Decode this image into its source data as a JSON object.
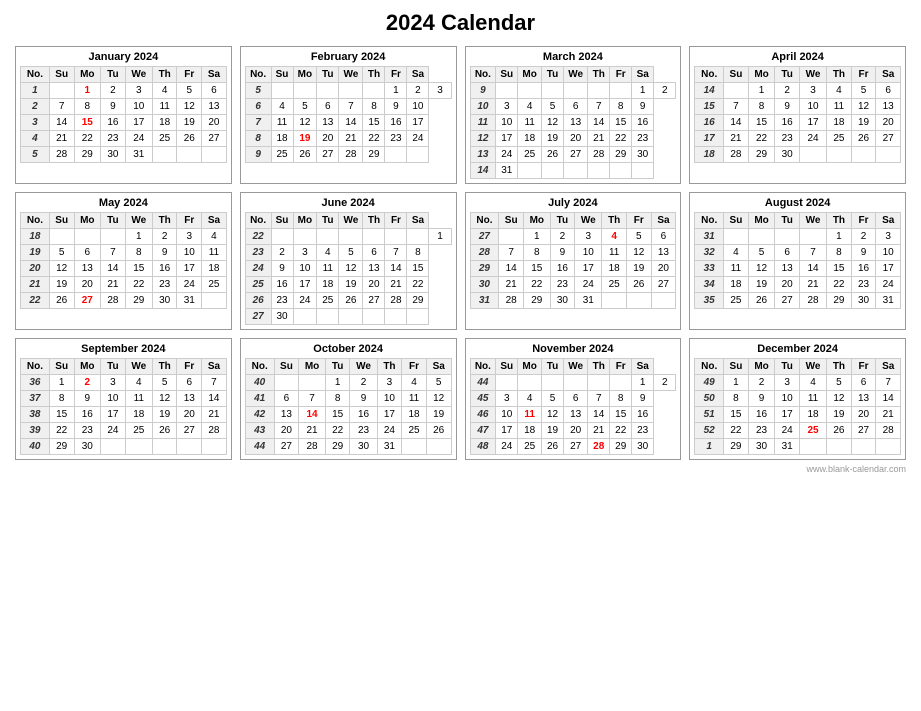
{
  "title": "2024 Calendar",
  "watermark": "www.blank-calendar.com",
  "months": [
    {
      "name": "January 2024",
      "days_header": [
        "No.",
        "Su",
        "Mo",
        "Tu",
        "We",
        "Th",
        "Fr",
        "Sa"
      ],
      "weeks": [
        {
          "num": "1",
          "days": [
            "",
            "1",
            "2",
            "3",
            "4",
            "5",
            "6"
          ],
          "holidays": [
            1
          ]
        },
        {
          "num": "2",
          "days": [
            "7",
            "8",
            "9",
            "10",
            "11",
            "12",
            "13"
          ],
          "holidays": []
        },
        {
          "num": "3",
          "days": [
            "14",
            "15",
            "16",
            "17",
            "18",
            "19",
            "20"
          ],
          "holidays": [
            15
          ]
        },
        {
          "num": "4",
          "days": [
            "21",
            "22",
            "23",
            "24",
            "25",
            "26",
            "27"
          ],
          "holidays": []
        },
        {
          "num": "5",
          "days": [
            "28",
            "29",
            "30",
            "31",
            "",
            "",
            ""
          ],
          "holidays": []
        }
      ]
    },
    {
      "name": "February 2024",
      "days_header": [
        "No.",
        "Su",
        "Mo",
        "Tu",
        "We",
        "Th",
        "Fr",
        "Sa"
      ],
      "weeks": [
        {
          "num": "5",
          "days": [
            "",
            "",
            "",
            "",
            "",
            "1",
            "2",
            "3"
          ],
          "holidays": []
        },
        {
          "num": "6",
          "days": [
            "4",
            "5",
            "6",
            "7",
            "8",
            "9",
            "10"
          ],
          "holidays": []
        },
        {
          "num": "7",
          "days": [
            "11",
            "12",
            "13",
            "14",
            "15",
            "16",
            "17"
          ],
          "holidays": []
        },
        {
          "num": "8",
          "days": [
            "18",
            "19",
            "20",
            "21",
            "22",
            "23",
            "24"
          ],
          "holidays": [
            19
          ]
        },
        {
          "num": "9",
          "days": [
            "25",
            "26",
            "27",
            "28",
            "29",
            "",
            ""
          ],
          "holidays": []
        }
      ]
    },
    {
      "name": "March 2024",
      "days_header": [
        "No.",
        "Su",
        "Mo",
        "Tu",
        "We",
        "Th",
        "Fr",
        "Sa"
      ],
      "weeks": [
        {
          "num": "9",
          "days": [
            "",
            "",
            "",
            "",
            "",
            "",
            "1",
            "2"
          ],
          "holidays": []
        },
        {
          "num": "10",
          "days": [
            "3",
            "4",
            "5",
            "6",
            "7",
            "8",
            "9"
          ],
          "holidays": []
        },
        {
          "num": "11",
          "days": [
            "10",
            "11",
            "12",
            "13",
            "14",
            "15",
            "16"
          ],
          "holidays": []
        },
        {
          "num": "12",
          "days": [
            "17",
            "18",
            "19",
            "20",
            "21",
            "22",
            "23"
          ],
          "holidays": []
        },
        {
          "num": "13",
          "days": [
            "24",
            "25",
            "26",
            "27",
            "28",
            "29",
            "30"
          ],
          "holidays": []
        },
        {
          "num": "14",
          "days": [
            "31",
            "",
            "",
            "",
            "",
            "",
            ""
          ],
          "holidays": []
        }
      ]
    },
    {
      "name": "April 2024",
      "days_header": [
        "No.",
        "Su",
        "Mo",
        "Tu",
        "We",
        "Th",
        "Fr",
        "Sa"
      ],
      "weeks": [
        {
          "num": "14",
          "days": [
            "",
            "1",
            "2",
            "3",
            "4",
            "5",
            "6"
          ],
          "holidays": []
        },
        {
          "num": "15",
          "days": [
            "7",
            "8",
            "9",
            "10",
            "11",
            "12",
            "13"
          ],
          "holidays": []
        },
        {
          "num": "16",
          "days": [
            "14",
            "15",
            "16",
            "17",
            "18",
            "19",
            "20"
          ],
          "holidays": []
        },
        {
          "num": "17",
          "days": [
            "21",
            "22",
            "23",
            "24",
            "25",
            "26",
            "27"
          ],
          "holidays": []
        },
        {
          "num": "18",
          "days": [
            "28",
            "29",
            "30",
            "",
            "",
            "",
            ""
          ],
          "holidays": []
        }
      ]
    },
    {
      "name": "May 2024",
      "days_header": [
        "No.",
        "Su",
        "Mo",
        "Tu",
        "We",
        "Th",
        "Fr",
        "Sa"
      ],
      "weeks": [
        {
          "num": "18",
          "days": [
            "",
            "",
            "",
            "1",
            "2",
            "3",
            "4"
          ],
          "holidays": []
        },
        {
          "num": "19",
          "days": [
            "5",
            "6",
            "7",
            "8",
            "9",
            "10",
            "11"
          ],
          "holidays": []
        },
        {
          "num": "20",
          "days": [
            "12",
            "13",
            "14",
            "15",
            "16",
            "17",
            "18"
          ],
          "holidays": []
        },
        {
          "num": "21",
          "days": [
            "19",
            "20",
            "21",
            "22",
            "23",
            "24",
            "25"
          ],
          "holidays": []
        },
        {
          "num": "22",
          "days": [
            "26",
            "27",
            "28",
            "29",
            "30",
            "31",
            ""
          ],
          "holidays": [
            27
          ]
        }
      ]
    },
    {
      "name": "June 2024",
      "days_header": [
        "No.",
        "Su",
        "Mo",
        "Tu",
        "We",
        "Th",
        "Fr",
        "Sa"
      ],
      "weeks": [
        {
          "num": "22",
          "days": [
            "",
            "",
            "",
            "",
            "",
            "",
            "",
            "1"
          ],
          "holidays": []
        },
        {
          "num": "23",
          "days": [
            "2",
            "3",
            "4",
            "5",
            "6",
            "7",
            "8"
          ],
          "holidays": []
        },
        {
          "num": "24",
          "days": [
            "9",
            "10",
            "11",
            "12",
            "13",
            "14",
            "15"
          ],
          "holidays": []
        },
        {
          "num": "25",
          "days": [
            "16",
            "17",
            "18",
            "19",
            "20",
            "21",
            "22"
          ],
          "holidays": []
        },
        {
          "num": "26",
          "days": [
            "23",
            "24",
            "25",
            "26",
            "27",
            "28",
            "29"
          ],
          "holidays": []
        },
        {
          "num": "27",
          "days": [
            "30",
            "",
            "",
            "",
            "",
            "",
            ""
          ],
          "holidays": []
        }
      ]
    },
    {
      "name": "July 2024",
      "days_header": [
        "No.",
        "Su",
        "Mo",
        "Tu",
        "We",
        "Th",
        "Fr",
        "Sa"
      ],
      "weeks": [
        {
          "num": "27",
          "days": [
            "",
            "1",
            "2",
            "3",
            "4",
            "5",
            "6"
          ],
          "holidays": [
            4
          ]
        },
        {
          "num": "28",
          "days": [
            "7",
            "8",
            "9",
            "10",
            "11",
            "12",
            "13"
          ],
          "holidays": []
        },
        {
          "num": "29",
          "days": [
            "14",
            "15",
            "16",
            "17",
            "18",
            "19",
            "20"
          ],
          "holidays": []
        },
        {
          "num": "30",
          "days": [
            "21",
            "22",
            "23",
            "24",
            "25",
            "26",
            "27"
          ],
          "holidays": []
        },
        {
          "num": "31",
          "days": [
            "28",
            "29",
            "30",
            "31",
            "",
            "",
            ""
          ],
          "holidays": []
        }
      ]
    },
    {
      "name": "August 2024",
      "days_header": [
        "No.",
        "Su",
        "Mo",
        "Tu",
        "We",
        "Th",
        "Fr",
        "Sa"
      ],
      "weeks": [
        {
          "num": "31",
          "days": [
            "",
            "",
            "",
            "",
            "1",
            "2",
            "3"
          ],
          "holidays": []
        },
        {
          "num": "32",
          "days": [
            "4",
            "5",
            "6",
            "7",
            "8",
            "9",
            "10"
          ],
          "holidays": []
        },
        {
          "num": "33",
          "days": [
            "11",
            "12",
            "13",
            "14",
            "15",
            "16",
            "17"
          ],
          "holidays": []
        },
        {
          "num": "34",
          "days": [
            "18",
            "19",
            "20",
            "21",
            "22",
            "23",
            "24"
          ],
          "holidays": []
        },
        {
          "num": "35",
          "days": [
            "25",
            "26",
            "27",
            "28",
            "29",
            "30",
            "31"
          ],
          "holidays": []
        }
      ]
    },
    {
      "name": "September 2024",
      "days_header": [
        "No.",
        "Su",
        "Mo",
        "Tu",
        "We",
        "Th",
        "Fr",
        "Sa"
      ],
      "weeks": [
        {
          "num": "36",
          "days": [
            "1",
            "2",
            "3",
            "4",
            "5",
            "6",
            "7"
          ],
          "holidays": [
            2
          ]
        },
        {
          "num": "37",
          "days": [
            "8",
            "9",
            "10",
            "11",
            "12",
            "13",
            "14"
          ],
          "holidays": []
        },
        {
          "num": "38",
          "days": [
            "15",
            "16",
            "17",
            "18",
            "19",
            "20",
            "21"
          ],
          "holidays": []
        },
        {
          "num": "39",
          "days": [
            "22",
            "23",
            "24",
            "25",
            "26",
            "27",
            "28"
          ],
          "holidays": []
        },
        {
          "num": "40",
          "days": [
            "29",
            "30",
            "",
            "",
            "",
            "",
            ""
          ],
          "holidays": []
        }
      ]
    },
    {
      "name": "October 2024",
      "days_header": [
        "No.",
        "Su",
        "Mo",
        "Tu",
        "We",
        "Th",
        "Fr",
        "Sa"
      ],
      "weeks": [
        {
          "num": "40",
          "days": [
            "",
            "",
            "1",
            "2",
            "3",
            "4",
            "5"
          ],
          "holidays": []
        },
        {
          "num": "41",
          "days": [
            "6",
            "7",
            "8",
            "9",
            "10",
            "11",
            "12"
          ],
          "holidays": []
        },
        {
          "num": "42",
          "days": [
            "13",
            "14",
            "15",
            "16",
            "17",
            "18",
            "19"
          ],
          "holidays": [
            14
          ]
        },
        {
          "num": "43",
          "days": [
            "20",
            "21",
            "22",
            "23",
            "24",
            "25",
            "26"
          ],
          "holidays": []
        },
        {
          "num": "44",
          "days": [
            "27",
            "28",
            "29",
            "30",
            "31",
            "",
            ""
          ],
          "holidays": []
        }
      ]
    },
    {
      "name": "November 2024",
      "days_header": [
        "No.",
        "Su",
        "Mo",
        "Tu",
        "We",
        "Th",
        "Fr",
        "Sa"
      ],
      "weeks": [
        {
          "num": "44",
          "days": [
            "",
            "",
            "",
            "",
            "",
            "",
            "1",
            "2"
          ],
          "holidays": []
        },
        {
          "num": "45",
          "days": [
            "3",
            "4",
            "5",
            "6",
            "7",
            "8",
            "9"
          ],
          "holidays": []
        },
        {
          "num": "46",
          "days": [
            "10",
            "11",
            "12",
            "13",
            "14",
            "15",
            "16"
          ],
          "holidays": [
            11
          ]
        },
        {
          "num": "47",
          "days": [
            "17",
            "18",
            "19",
            "20",
            "21",
            "22",
            "23"
          ],
          "holidays": []
        },
        {
          "num": "48",
          "days": [
            "24",
            "25",
            "26",
            "27",
            "28",
            "29",
            "30"
          ],
          "holidays": [
            28
          ]
        }
      ]
    },
    {
      "name": "December 2024",
      "days_header": [
        "No.",
        "Su",
        "Mo",
        "Tu",
        "We",
        "Th",
        "Fr",
        "Sa"
      ],
      "weeks": [
        {
          "num": "49",
          "days": [
            "1",
            "2",
            "3",
            "4",
            "5",
            "6",
            "7"
          ],
          "holidays": []
        },
        {
          "num": "50",
          "days": [
            "8",
            "9",
            "10",
            "11",
            "12",
            "13",
            "14"
          ],
          "holidays": []
        },
        {
          "num": "51",
          "days": [
            "15",
            "16",
            "17",
            "18",
            "19",
            "20",
            "21"
          ],
          "holidays": []
        },
        {
          "num": "52",
          "days": [
            "22",
            "23",
            "24",
            "25",
            "26",
            "27",
            "28"
          ],
          "holidays": [
            25
          ]
        },
        {
          "num": "1",
          "days": [
            "29",
            "30",
            "31",
            "",
            "",
            "",
            ""
          ],
          "holidays": []
        }
      ]
    }
  ]
}
